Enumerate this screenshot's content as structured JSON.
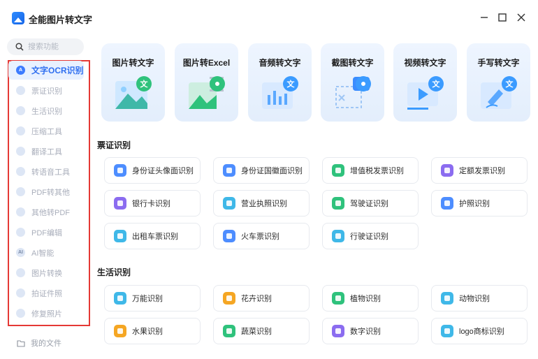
{
  "app": {
    "title": "全能图片转文字"
  },
  "window_controls": {
    "minimize": "—",
    "maximize": "☐",
    "close": "✕"
  },
  "search": {
    "placeholder": "搜索功能"
  },
  "sidebar": {
    "items": [
      {
        "label": "文字OCR识别",
        "icon": "ocr-icon",
        "active": true
      },
      {
        "label": "票证识别",
        "icon": "ticket-icon"
      },
      {
        "label": "生活识别",
        "icon": "leaf-icon"
      },
      {
        "label": "压缩工具",
        "icon": "compress-icon"
      },
      {
        "label": "翻译工具",
        "icon": "translate-icon"
      },
      {
        "label": "转语音工具",
        "icon": "speech-icon"
      },
      {
        "label": "PDF转其他",
        "icon": "pdf-icon"
      },
      {
        "label": "其他转PDF",
        "icon": "pdf-convert-icon"
      },
      {
        "label": "PDF编辑",
        "icon": "pdf-edit-icon"
      },
      {
        "label": "AI智能",
        "icon": "ai-icon",
        "glyph": "AI"
      },
      {
        "label": "图片转换",
        "icon": "image-convert-icon"
      },
      {
        "label": "拍证件照",
        "icon": "id-photo-icon"
      },
      {
        "label": "修复照片",
        "icon": "photo-repair-icon"
      }
    ],
    "my_files": "我的文件"
  },
  "top_cards": [
    {
      "label": "图片转文字",
      "icon": "image-to-text-icon",
      "badge": "文",
      "badge_color": "#2fc27c"
    },
    {
      "label": "图片转Excel",
      "icon": "image-to-excel-icon",
      "badge": "",
      "badge_color": "#2fc27c"
    },
    {
      "label": "音频转文字",
      "icon": "audio-to-text-icon",
      "badge": "文",
      "badge_color": "#3b9bff"
    },
    {
      "label": "截图转文字",
      "icon": "screenshot-to-text-icon",
      "badge": "",
      "badge_color": "#3b9bff"
    },
    {
      "label": "视频转文字",
      "icon": "video-to-text-icon",
      "badge": "文",
      "badge_color": "#3b9bff"
    },
    {
      "label": "手写转文字",
      "icon": "handwriting-to-text-icon",
      "badge": "文",
      "badge_color": "#3b9bff"
    }
  ],
  "sections": [
    {
      "title": "票证识别",
      "items": [
        {
          "label": "身份证头像面识别",
          "icon": "id-card-front-icon",
          "color": "#4d8dff"
        },
        {
          "label": "身份证国徽面识别",
          "icon": "id-card-back-icon",
          "color": "#4d8dff"
        },
        {
          "label": "增值税发票识别",
          "icon": "vat-invoice-icon",
          "color": "#2fc27c"
        },
        {
          "label": "定额发票识别",
          "icon": "fixed-invoice-icon",
          "color": "#8b6cf0"
        },
        {
          "label": "银行卡识别",
          "icon": "bank-card-icon",
          "color": "#8b6cf0"
        },
        {
          "label": "营业执照识别",
          "icon": "business-license-icon",
          "color": "#3fb8e8"
        },
        {
          "label": "驾驶证识别",
          "icon": "driver-license-icon",
          "color": "#2fc27c"
        },
        {
          "label": "护照识别",
          "icon": "passport-icon",
          "color": "#4d8dff"
        },
        {
          "label": "出租车票识别",
          "icon": "taxi-ticket-icon",
          "color": "#3fb8e8"
        },
        {
          "label": "火车票识别",
          "icon": "train-ticket-icon",
          "color": "#4d8dff"
        },
        {
          "label": "行驶证识别",
          "icon": "vehicle-license-icon",
          "color": "#3fb8e8"
        }
      ]
    },
    {
      "title": "生活识别",
      "items": [
        {
          "label": "万能识别",
          "icon": "universal-icon",
          "color": "#3fb8e8"
        },
        {
          "label": "花卉识别",
          "icon": "flower-icon",
          "color": "#f5a623"
        },
        {
          "label": "植物识别",
          "icon": "plant-icon",
          "color": "#2fc27c"
        },
        {
          "label": "动物识别",
          "icon": "animal-icon",
          "color": "#3fb8e8"
        },
        {
          "label": "水果识别",
          "icon": "fruit-icon",
          "color": "#f5a623"
        },
        {
          "label": "蔬菜识别",
          "icon": "vegetable-icon",
          "color": "#2fc27c"
        },
        {
          "label": "数字识别",
          "icon": "digit-icon",
          "color": "#8b6cf0"
        },
        {
          "label": "logo商标识别",
          "icon": "logo-icon",
          "color": "#3fb8e8"
        }
      ]
    }
  ]
}
